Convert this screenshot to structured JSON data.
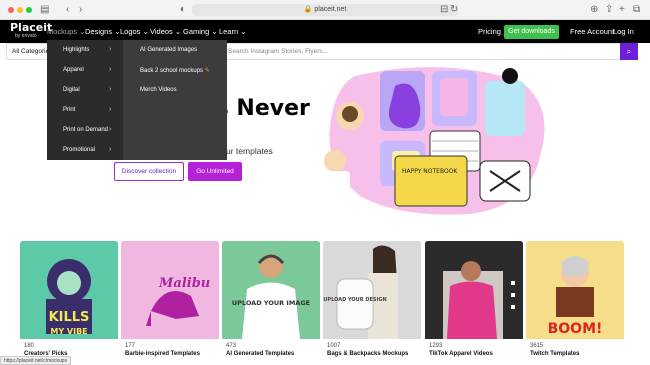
{
  "browser": {
    "url": "placeit.net",
    "status_url": "https://placeit.net/c/mockups"
  },
  "nav": {
    "logo": "Placeit",
    "logo_sub": "by envato",
    "items": [
      "Mockups",
      "Designs",
      "Logos",
      "Videos",
      "Gaming",
      "Learn"
    ],
    "pricing": "Pricing",
    "cta": "Get downloads",
    "free_account": "Free Account",
    "login": "Log In"
  },
  "search": {
    "category": "All Categories",
    "placeholder": "Search Instagram Stories, Flyers..."
  },
  "menu": {
    "left": [
      "Highlights",
      "Apparel",
      "Digital",
      "Print",
      "Print on Demand",
      "Promotional"
    ],
    "right": [
      "AI Generated Images",
      "Back 2 school mockups",
      "Merch Videos"
    ]
  },
  "hero": {
    "title": "us Never",
    "subtitle": "ur templates",
    "btn_discover": "Discover collection",
    "btn_unlimited": "Go Unlimited"
  },
  "cards": [
    {
      "count": "180",
      "title": "Creators' Picks"
    },
    {
      "count": "177",
      "title": "Barbie-inspired Templates"
    },
    {
      "count": "473",
      "title": "AI Generated Templates"
    },
    {
      "count": "1007",
      "title": "Bags & Backpacks Mockups"
    },
    {
      "count": "1293",
      "title": "TikTok Apparel Videos"
    },
    {
      "count": "3615",
      "title": "Twitch Templates"
    }
  ],
  "card_texts": {
    "kills": "KILLS",
    "myvibe": "MY VIBE",
    "malibu": "Malibu",
    "upload": "UPLOAD YOUR IMAGE",
    "bag": "UPLOAD YOUR DESIGN",
    "boom": "BOOM!",
    "notebook": "HAPPY NOTEBOOK"
  },
  "colors": {
    "brand_purple": "#6c1fd7",
    "cta_green": "#3fc04f",
    "unlimited": "#b521d6"
  }
}
